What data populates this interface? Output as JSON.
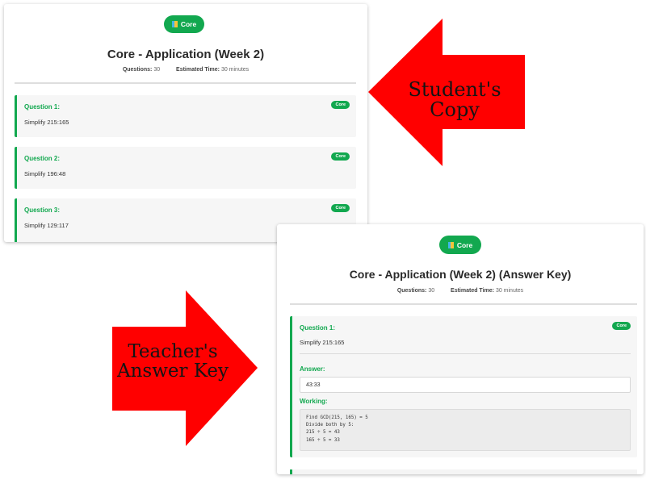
{
  "colors": {
    "accent": "#12a84f",
    "arrow": "#ff0000"
  },
  "student": {
    "badge": "Core",
    "title": "Core - Application (Week 2)",
    "questions_label": "Questions:",
    "questions_value": "30",
    "time_label": "Estimated Time:",
    "time_value": "30 minutes",
    "questions": [
      {
        "label": "Question 1:",
        "text": "Simplify 215:165",
        "badge": "Core"
      },
      {
        "label": "Question 2:",
        "text": "Simplify 196:48",
        "badge": "Core"
      },
      {
        "label": "Question 3:",
        "text": "Simplify 129:117",
        "badge": "Core"
      }
    ]
  },
  "teacher": {
    "badge": "Core",
    "title": "Core - Application (Week 2) (Answer Key)",
    "questions_label": "Questions:",
    "questions_value": "30",
    "time_label": "Estimated Time:",
    "time_value": "30 minutes",
    "question": {
      "label": "Question 1:",
      "text": "Simplify 215:165",
      "badge": "Core",
      "answer_label": "Answer:",
      "answer_value": "43:33",
      "working_label": "Working:",
      "working_lines": [
        "Find GCD(215, 165) = 5",
        "Divide both by 5:",
        "215 ÷ 5 = 43",
        "165 ÷ 5 = 33"
      ]
    }
  },
  "annotations": {
    "student_arrow_text": "Student's Copy",
    "teacher_arrow_line1": "Teacher's",
    "teacher_arrow_line2": "Answer Key"
  },
  "icons": {
    "badge_icon": "book-icon",
    "arrow_left": "arrow-left-icon",
    "arrow_right": "arrow-right-icon"
  }
}
